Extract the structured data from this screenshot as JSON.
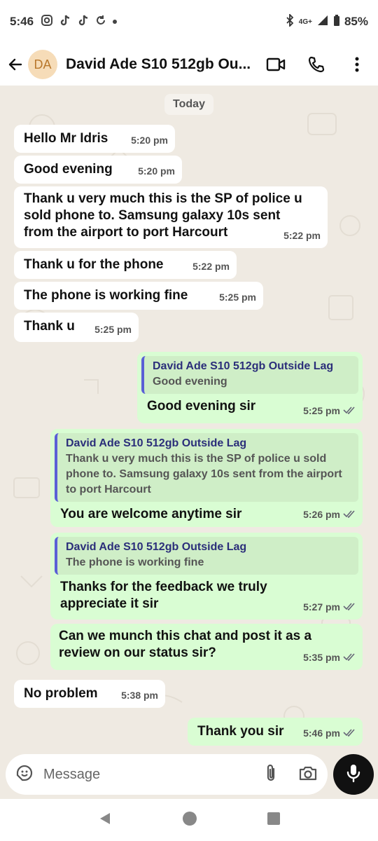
{
  "status_bar": {
    "time": "5:46",
    "network": "4G+",
    "battery": "85%",
    "icons": [
      "instagram-icon",
      "tiktok-icon",
      "tiktok-icon",
      "sync-icon",
      "dot-icon",
      "bluetooth-icon",
      "signal-icon",
      "battery-icon"
    ]
  },
  "header": {
    "avatar_initials": "DA",
    "contact_name": "David Ade S10 512gb Ou...",
    "icons": [
      "back-arrow-icon",
      "video-call-icon",
      "phone-icon",
      "more-vert-icon"
    ]
  },
  "chat": {
    "date_label": "Today",
    "messages": [
      {
        "dir": "in",
        "text": "Hello Mr Idris",
        "time": "5:20 pm"
      },
      {
        "dir": "in",
        "text": "Good evening",
        "time": "5:20 pm"
      },
      {
        "dir": "in",
        "text": "Thank u very much this is the SP of police u sold phone to. Samsung galaxy 10s sent from the airport to port Harcourt",
        "time": "5:22 pm"
      },
      {
        "dir": "in",
        "text": "Thank u for the phone",
        "time": "5:22 pm"
      },
      {
        "dir": "in",
        "text": "The phone is working fine",
        "time": "5:25 pm"
      },
      {
        "dir": "in",
        "text": "Thank u",
        "time": "5:25 pm"
      },
      {
        "dir": "out",
        "quote_name": "David Ade S10 512gb Outside Lag",
        "quote_text": "Good evening",
        "text": "Good evening sir",
        "time": "5:25 pm"
      },
      {
        "dir": "out",
        "quote_name": "David Ade S10 512gb Outside Lag",
        "quote_text": "Thank u very much this is the SP of police u sold phone to. Samsung galaxy 10s sent from the airport to port Harcourt",
        "text": "You are welcome anytime sir",
        "time": "5:26 pm"
      },
      {
        "dir": "out",
        "quote_name": "David Ade S10 512gb Outside Lag",
        "quote_text": "The phone is working fine",
        "text": "Thanks for the feedback we truly appreciate it sir",
        "time": "5:27 pm"
      },
      {
        "dir": "out",
        "text": "Can we munch this chat and post it as a review on our status sir?",
        "time": "5:35 pm"
      },
      {
        "dir": "in",
        "text": "No problem",
        "time": "5:38 pm"
      },
      {
        "dir": "out",
        "text": "Thank you sir",
        "time": "5:46 pm"
      }
    ]
  },
  "composer": {
    "placeholder": "Message",
    "icons": [
      "sticker-icon",
      "attach-icon",
      "camera-icon",
      "mic-icon"
    ]
  },
  "nav": {
    "icons": [
      "back-triangle-icon",
      "home-circle-icon",
      "recents-square-icon"
    ]
  },
  "colors": {
    "incoming_bubble": "#ffffff",
    "outgoing_bubble": "#d9fdd3",
    "quote_bar": "#5a5fd6",
    "chat_background": "#efeae2"
  }
}
